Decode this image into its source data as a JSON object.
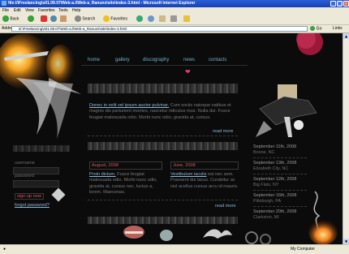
{
  "window": {
    "title": "file://\\Freelancing\\s01.09.07\\Web-a.l\\Web-a_Ranuns\\site\\index-3.html - Microsoft Internet Explorer"
  },
  "menu": [
    "File",
    "Edit",
    "View",
    "Favorites",
    "Tools",
    "Help"
  ],
  "toolbar": {
    "back": "Back",
    "search": "Search",
    "favorites": "Favorites"
  },
  "address": {
    "label": "Address",
    "value": "D:\\Freelancing\\s01.09.07\\Web-a.l\\Web-a_Ranuns\\site\\index-3.html",
    "go": "Go",
    "links": "Links"
  },
  "status": {
    "computer": "My Computer"
  },
  "site": {
    "nav": [
      "home",
      "gallery",
      "discography",
      "news",
      "contacts"
    ],
    "intro": {
      "lead": "Donec in velit vel ipsum auctor pulvinar.",
      "body": " Cum sociis natoque natibus et magnis dis parturient montes, nascetur ridiculus mus. Nulla dui. Fusce feugiat malesuada odio. Morbi nunc odio, gravida at, cursus.",
      "more": "read more"
    },
    "login": {
      "username": "username",
      "password": "password",
      "signup": "sign up now",
      "forgot": "forgot password?"
    },
    "news": [
      {
        "date": "August, 2008",
        "lead": "Proin dictum.",
        "body": " Fusce feugiat malesuada odio. Morbi nunc odio, gravida at, cursus nec, luctus a, lorem. Maecenas."
      },
      {
        "date": "June, 2008",
        "lead": "Vestibulum iaculis",
        "body": " est nec sem. Praesent dui lacus. Curabitur ac nisl acellus cursus arcu id mauris."
      }
    ],
    "more2": "read more",
    "events": [
      {
        "date": "September 11th, 2008",
        "place": "Boone, NC"
      },
      {
        "date": "September 13th, 2008",
        "place": "Elizabeth City, NC"
      },
      {
        "date": "September 12th, 2008",
        "place": "Big Flats, NY"
      },
      {
        "date": "September 16th, 2008",
        "place": "Pittsburgh, PA"
      },
      {
        "date": "September 20th, 2008",
        "place": "Clarkston, MI"
      }
    ]
  }
}
